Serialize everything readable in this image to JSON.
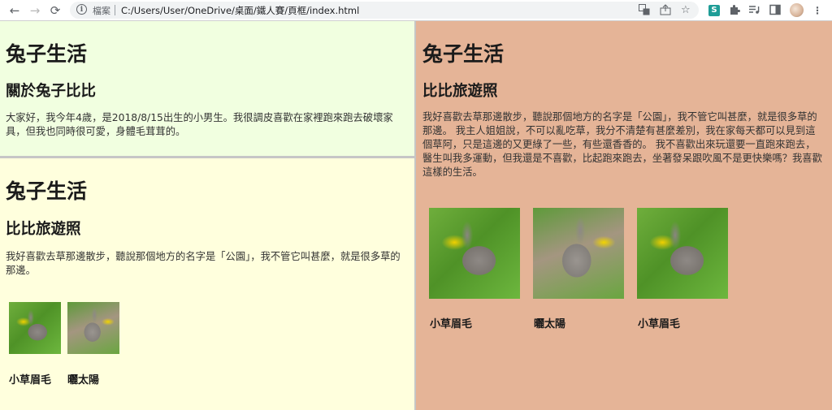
{
  "browser": {
    "nav": {
      "back": "←",
      "forward": "→",
      "reload": "⟳"
    },
    "omnibox": {
      "security_label": "檔案",
      "url": "C:/Users/User/OneDrive/桌面/鐵人賽/頁框/index.html"
    },
    "icons": [
      "translate-icon",
      "share-icon",
      "star-icon",
      "extension-s-icon",
      "puzzle-icon",
      "playlist-icon",
      "sidepanel-icon",
      "avatar",
      "menu-icon"
    ],
    "ext_s_label": "S"
  },
  "frames": {
    "left_top": {
      "site_title": "兔子生活",
      "section_title": "關於兔子比比",
      "text": "大家好，我今年4歲，是2018/8/15出生的小男生。我很調皮喜歡在家裡跑來跑去破壞家具，但我也同時很可愛，身體毛茸茸的。"
    },
    "left_bottom": {
      "site_title": "兔子生活",
      "section_title": "比比旅遊照",
      "text": "我好喜歡去草那邊散步，聽說那個地方的名字是「公園」，我不管它叫甚麼，就是很多草的那邊。",
      "photos": [
        {
          "caption": "小草眉毛"
        },
        {
          "caption": "曬太陽"
        }
      ]
    },
    "right": {
      "site_title": "兔子生活",
      "section_title": "比比旅遊照",
      "text": "我好喜歡去草那邊散步，聽說那個地方的名字是「公園」，我不管它叫甚麼，就是很多草的那邊。 我主人姐姐說，不可以亂吃草，我分不清楚有甚麼差別，我在家每天都可以見到這個草阿，只是這邊的又更綠了一些，有些還香香的。 我不喜歡出來玩還要一直跑來跑去，醫生叫我多運動，但我還是不喜歡，比起跑來跑去，坐著發呆跟吹風不是更快樂嗎？我喜歡這樣的生活。",
      "photos": [
        {
          "caption": "小草眉毛"
        },
        {
          "caption": "曬太陽"
        },
        {
          "caption": "小草眉毛"
        }
      ]
    }
  },
  "colors": {
    "left_top_bg": "#f1ffe0",
    "left_bottom_bg": "#ffffdd",
    "right_bg": "#e5b497"
  }
}
